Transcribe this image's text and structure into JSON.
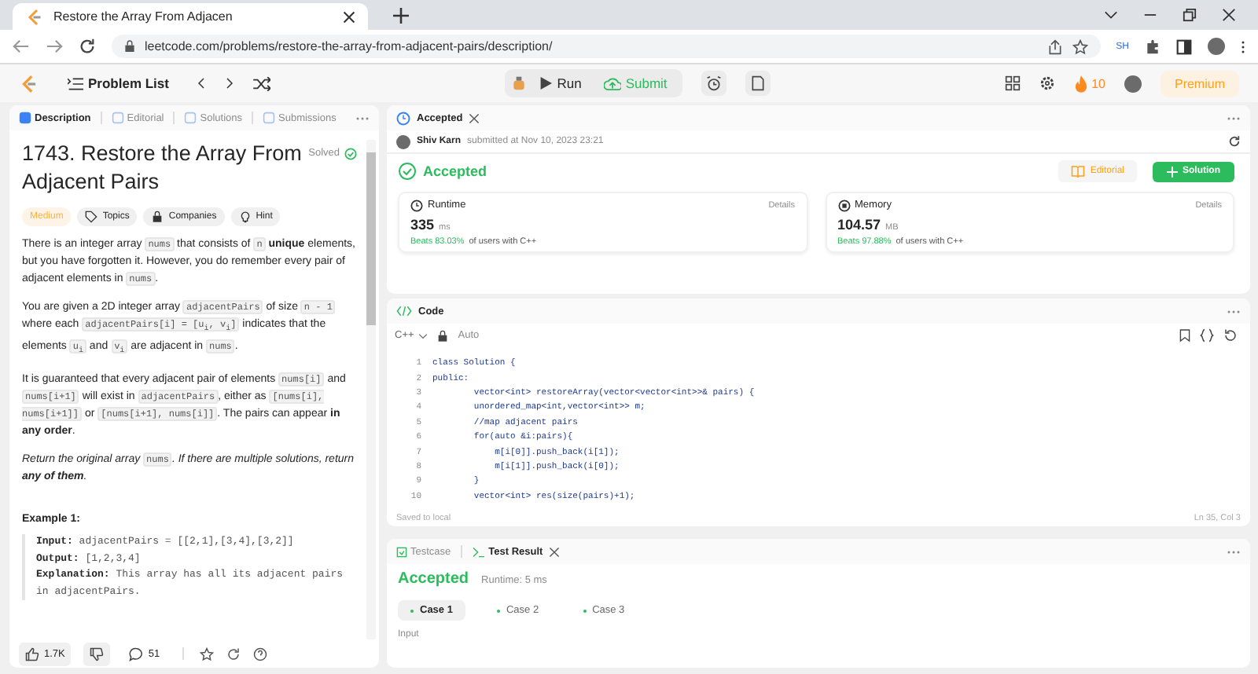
{
  "browser": {
    "tab_title": "Restore the Array From Adjacen",
    "url": "leetcode.com/problems/restore-the-array-from-adjacent-pairs/description/",
    "profile_badge": "SH"
  },
  "nav": {
    "problem_list": "Problem List",
    "run": "Run",
    "submit": "Submit",
    "streak": "10",
    "premium": "Premium"
  },
  "left_tabs": [
    {
      "label": "Description",
      "selected": true
    },
    {
      "label": "Editorial",
      "selected": false
    },
    {
      "label": "Solutions",
      "selected": false
    },
    {
      "label": "Submissions",
      "selected": false
    }
  ],
  "problem": {
    "title": "1743. Restore the Array From Adjacent Pairs",
    "status": "Solved",
    "difficulty": "Medium",
    "tags": [
      "Topics",
      "Companies",
      "Hint"
    ],
    "paragraphs": [
      [
        {
          "kind": "text",
          "text": "There is an integer array "
        },
        {
          "kind": "code",
          "text": "nums"
        },
        {
          "kind": "text",
          "text": " that consists of "
        },
        {
          "kind": "code",
          "text": "n"
        },
        {
          "kind": "bold",
          "text": " unique"
        },
        {
          "kind": "text",
          "text": " elements, but you have forgotten it. However, you do remember every pair of adjacent elements in "
        },
        {
          "kind": "code",
          "text": "nums"
        },
        {
          "kind": "text",
          "text": "."
        }
      ],
      [
        {
          "kind": "text",
          "text": "You are given a 2D integer array "
        },
        {
          "kind": "code",
          "text": "adjacentPairs"
        },
        {
          "kind": "text",
          "text": " of size "
        },
        {
          "kind": "code",
          "text": "n - 1"
        },
        {
          "kind": "text",
          "text": " where each "
        },
        {
          "kind": "code",
          "text": "adjacentPairs[i] = [u$_{i}$, v$_{i}$]"
        },
        {
          "kind": "text",
          "text": " indicates that the elements "
        },
        {
          "kind": "code",
          "text": "u$_{i}$"
        },
        {
          "kind": "text",
          "text": " and "
        },
        {
          "kind": "code",
          "text": "v$_{i}$"
        },
        {
          "kind": "text",
          "text": " are adjacent in "
        },
        {
          "kind": "code",
          "text": "nums"
        },
        {
          "kind": "text",
          "text": "."
        }
      ],
      [
        {
          "kind": "text",
          "text": "It is guaranteed that every adjacent pair of elements "
        },
        {
          "kind": "code",
          "text": "nums[i]"
        },
        {
          "kind": "text",
          "text": " and "
        },
        {
          "kind": "code",
          "text": "nums[i+1]"
        },
        {
          "kind": "text",
          "text": " will exist in "
        },
        {
          "kind": "code",
          "text": "adjacentPairs"
        },
        {
          "kind": "text",
          "text": ", either as "
        },
        {
          "kind": "code",
          "text": "[nums[i], nums[i+1]]"
        },
        {
          "kind": "text",
          "text": " or "
        },
        {
          "kind": "code",
          "text": "[nums[i+1], nums[i]]"
        },
        {
          "kind": "text",
          "text": ". The pairs can appear "
        },
        {
          "kind": "bold",
          "text": "in any order"
        },
        {
          "kind": "text",
          "text": "."
        }
      ],
      [
        {
          "kind": "italic",
          "text": "Return the original array "
        },
        {
          "kind": "code",
          "text": "nums"
        },
        {
          "kind": "italic",
          "text": ". If there are multiple solutions, return "
        },
        {
          "kind": "bold_italic",
          "text": "any of them"
        },
        {
          "kind": "italic",
          "text": "."
        }
      ]
    ],
    "example_title": "Example 1:",
    "example_lines": [
      {
        "label": "Input:",
        "value": "adjacentPairs = [[2,1],[3,4],[3,2]]"
      },
      {
        "label": "Output:",
        "value": "[1,2,3,4]"
      },
      {
        "label": "Explanation:",
        "value": "This array has all its adjacent pairs in adjacentPairs."
      }
    ],
    "likes": "1.7K",
    "comments": "51"
  },
  "submission": {
    "tab": "Accepted",
    "user": "Shiv Karn",
    "submitted": "submitted at Nov 10, 2023 23:21",
    "status": "Accepted",
    "editorial": "Editorial",
    "solution": "Solution",
    "stats": [
      {
        "kind": "runtime",
        "label": "Runtime",
        "details": "Details",
        "value": "335",
        "unit": "ms",
        "beats": "Beats 83.03%",
        "suffix": "of users with C++"
      },
      {
        "kind": "memory",
        "label": "Memory",
        "details": "Details",
        "value": "104.57",
        "unit": "MB",
        "beats": "Beats 97.88%",
        "suffix": "of users with C++"
      }
    ]
  },
  "code": {
    "tab": "Code",
    "language": "C++",
    "mode": "Auto",
    "lines": [
      {
        "number": "1",
        "text": "class Solution {"
      },
      {
        "number": "2",
        "text": "public:"
      },
      {
        "number": "3",
        "text": "        vector<int> restoreArray(vector<vector<int>>& pairs) {"
      },
      {
        "number": "4",
        "text": "        unordered_map<int,vector<int>> m;"
      },
      {
        "number": "5",
        "text": "        //map adjacent pairs"
      },
      {
        "number": "6",
        "text": "        for(auto &i:pairs){"
      },
      {
        "number": "7",
        "text": "            m[i[0]].push_back(i[1]);"
      },
      {
        "number": "8",
        "text": "            m[i[1]].push_back(i[0]);"
      },
      {
        "number": "9",
        "text": "        }"
      },
      {
        "number": "10",
        "text": "        vector<int> res(size(pairs)+1);"
      }
    ],
    "saved": "Saved to local",
    "cursor": "Ln 35, Col 3"
  },
  "test_tabs": [
    {
      "label": "Testcase",
      "selected": false
    },
    {
      "label": "Test Result",
      "selected": true
    }
  ],
  "result": {
    "status": "Accepted",
    "runtime": "Runtime: 5 ms",
    "cases": [
      {
        "label": "Case 1",
        "selected": true
      },
      {
        "label": "Case 2",
        "selected": false
      },
      {
        "label": "Case 3",
        "selected": false
      }
    ],
    "input_label": "Input"
  }
}
